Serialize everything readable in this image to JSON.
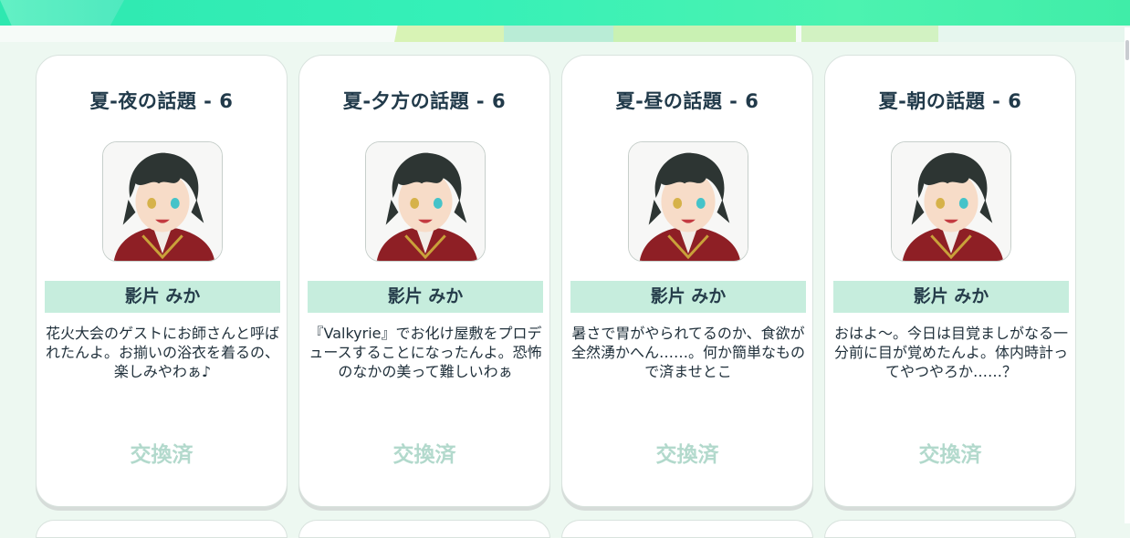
{
  "cards": [
    {
      "title": "夏-夜の話題 - 6",
      "name": "影片 みか",
      "quote": "花火大会のゲストにお師さんと呼ばれたんよ。お揃いの浴衣を着るの、楽しみやわぁ♪",
      "status": "交換済"
    },
    {
      "title": "夏-夕方の話題 - 6",
      "name": "影片 みか",
      "quote": "『Valkyrie』でお化け屋敷をプロデュースすることになったんよ。恐怖のなかの美って難しいわぁ",
      "status": "交換済"
    },
    {
      "title": "夏-昼の話題 - 6",
      "name": "影片 みか",
      "quote": "暑さで胃がやられてるのか、食欲が全然湧かへん……。何か簡単なもので済ませとこ",
      "status": "交換済"
    },
    {
      "title": "夏-朝の話題 - 6",
      "name": "影片 みか",
      "quote": "おはよ～。今日は目覚ましがなる一分前に目が覚めたんよ。体内時計ってやつやろか……？",
      "status": "交換済"
    }
  ],
  "colors": {
    "accent": "#35f0b8",
    "name_bar": "#c6eddd",
    "status": "#b2d9cc",
    "background": "#edf8f1"
  },
  "icons": {
    "portrait": "character-portrait"
  }
}
